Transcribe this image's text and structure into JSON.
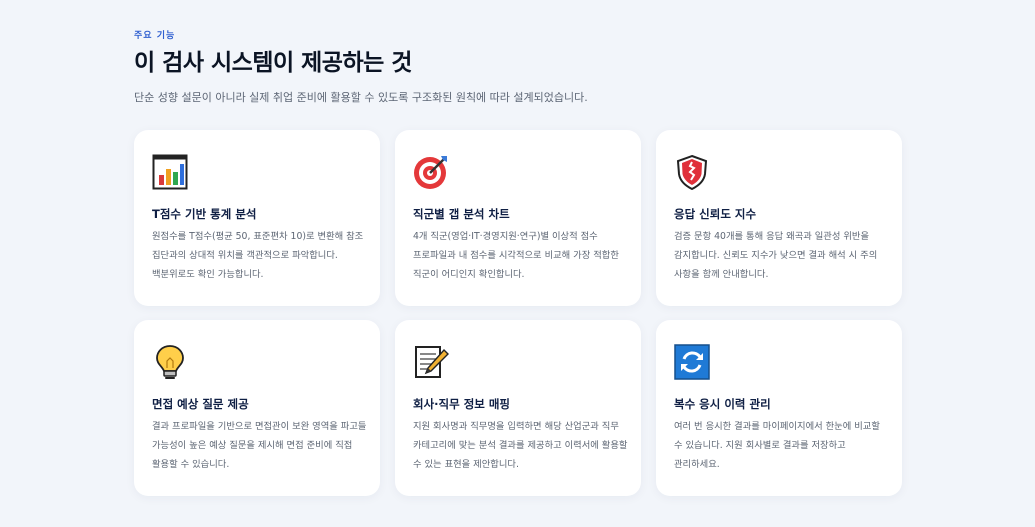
{
  "header": {
    "eyebrow": "주요 기능",
    "title": "이 검사 시스템이 제공하는 것",
    "subtitle": "단순 성향 설문이 아니라 실제 취업 준비에 활용할 수 있도록 구조화된 원칙에 따라 설계되었습니다."
  },
  "features": [
    {
      "icon": "bar-chart-icon",
      "title": "T점수 기반 통계 분석",
      "description": "원점수를 T점수(평균 50, 표준편차 10)로 변환해 참조 집단과의 상대적 위치를 객관적으로 파악합니다. 백분위로도 확인 가능합니다."
    },
    {
      "icon": "target-icon",
      "title": "직군별 갭 분석 차트",
      "description": "4개 직군(영업·IT·경영지원·연구)별 이상적 점수 프로파일과 내 점수를 시각적으로 비교해 가장 적합한 직군이 어디인지 확인합니다."
    },
    {
      "icon": "shield-icon",
      "title": "응답 신뢰도 지수",
      "description": "검증 문항 40개를 통해 응답 왜곡과 일관성 위반을 감지합니다. 신뢰도 지수가 낮으면 결과 해석 시 주의 사항을 함께 안내합니다."
    },
    {
      "icon": "lightbulb-icon",
      "title": "면접 예상 질문 제공",
      "description": "결과 프로파일을 기반으로 면접관이 보완 영역을 파고들 가능성이 높은 예상 질문을 제시해 면접 준비에 직접 활용할 수 있습니다."
    },
    {
      "icon": "memo-icon",
      "title": "회사·직무 정보 매핑",
      "description": "지원 회사명과 직무명을 입력하면 해당 산업군과 직무 카테고리에 맞는 분석 결과를 제공하고 이력서에 활용할 수 있는 표현을 제안합니다."
    },
    {
      "icon": "refresh-icon",
      "title": "복수 응시 이력 관리",
      "description": "여러 번 응시한 결과를 마이페이지에서 한눈에 비교할 수 있습니다. 지원 회사별로 결과를 저장하고 관리하세요."
    }
  ]
}
